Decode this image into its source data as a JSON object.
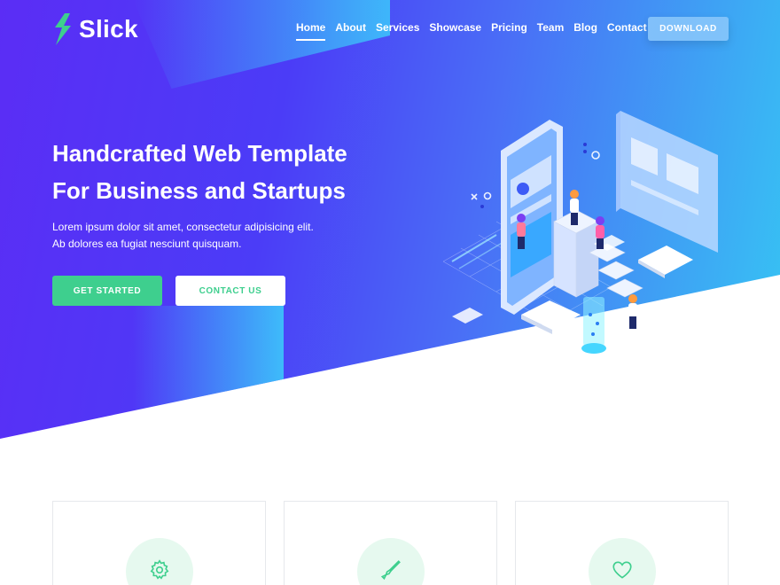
{
  "brand": {
    "name": "Slick",
    "accent": "#3ecf8e"
  },
  "nav": {
    "items": [
      {
        "label": "Home",
        "active": true
      },
      {
        "label": "About"
      },
      {
        "label": "Services"
      },
      {
        "label": "Showcase"
      },
      {
        "label": "Pricing"
      },
      {
        "label": "Team"
      },
      {
        "label": "Blog"
      },
      {
        "label": "Contact"
      }
    ],
    "download_label": "DOWNLOAD"
  },
  "hero": {
    "headline_line1": "Handcrafted Web Template",
    "headline_line2": "For Business and Startups",
    "subtext": "Lorem ipsum dolor sit amet, consectetur adipisicing elit. Ab dolores ea fugiat nesciunt quisquam.",
    "primary_cta": "GET STARTED",
    "secondary_cta": "CONTACT US"
  },
  "features": [
    {
      "icon": "gear-icon"
    },
    {
      "icon": "brush-icon"
    },
    {
      "icon": "heart-icon"
    }
  ]
}
